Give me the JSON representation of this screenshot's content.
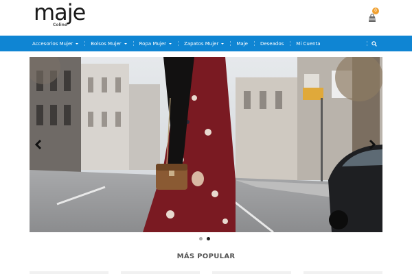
{
  "brand": {
    "name": "maje",
    "sub": "Coline"
  },
  "cart": {
    "count": "0",
    "icon": "shopping-bag-icon"
  },
  "nav": {
    "items": [
      {
        "label": "Accesorios Mujer",
        "dropdown": true
      },
      {
        "label": "Bolsos Mujer",
        "dropdown": true
      },
      {
        "label": "Ropa Mujer",
        "dropdown": true
      },
      {
        "label": "Zapatos Mujer",
        "dropdown": true
      },
      {
        "label": "Maje",
        "dropdown": false
      },
      {
        "label": "Deseados",
        "dropdown": false
      },
      {
        "label": "Mi Cuenta",
        "dropdown": false
      }
    ],
    "search_icon": "search-icon"
  },
  "slider": {
    "slides": 2,
    "active": 2
  },
  "popular": {
    "title": "MÁS POPULAR"
  },
  "colors": {
    "nav_bg": "#0f85d3",
    "badge": "#f0a030",
    "text": "#555555"
  }
}
